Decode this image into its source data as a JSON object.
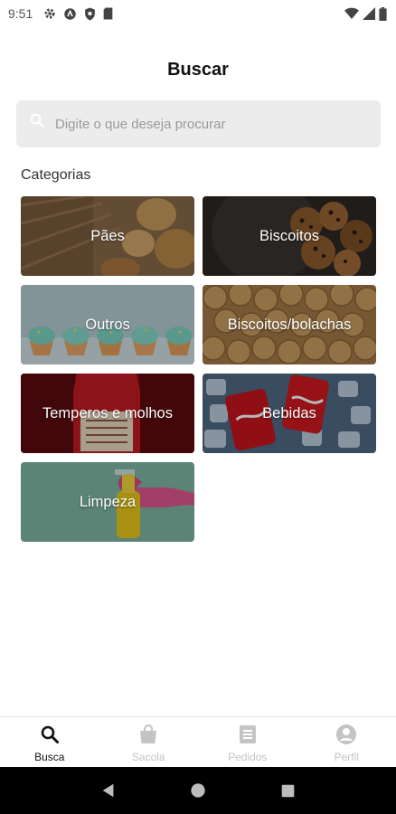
{
  "status_bar": {
    "time": "9:51",
    "icons": [
      "settings-icon",
      "sync-icon",
      "shield-icon",
      "sd-card-icon"
    ],
    "right_icons": [
      "wifi-icon",
      "signal-icon",
      "battery-icon"
    ]
  },
  "header": {
    "title": "Buscar"
  },
  "search": {
    "placeholder": "Digite o que deseja procurar",
    "value": ""
  },
  "categories_label": "Categorias",
  "categories": [
    {
      "label": "Pães",
      "image": "bread"
    },
    {
      "label": "Biscoitos",
      "image": "cookies"
    },
    {
      "label": "Outros",
      "image": "cupcakes"
    },
    {
      "label": "Biscoitos/bolachas",
      "image": "crackers"
    },
    {
      "label": "Temperos e molhos",
      "image": "ketchup"
    },
    {
      "label": "Bebidas",
      "image": "soda-cans"
    },
    {
      "label": "Limpeza",
      "image": "spray-bottle"
    }
  ],
  "bottom_nav": [
    {
      "label": "Busca",
      "icon": "search-icon",
      "active": true
    },
    {
      "label": "Sacola",
      "icon": "bag-icon",
      "active": false
    },
    {
      "label": "Pedidos",
      "icon": "receipt-icon",
      "active": false
    },
    {
      "label": "Perfil",
      "icon": "profile-icon",
      "active": false
    }
  ],
  "system_nav": [
    "back-icon",
    "home-icon",
    "recents-icon"
  ],
  "colors": {
    "search_bg": "#ececec",
    "active_nav": "#111111",
    "inactive_nav": "#c4c4c4"
  }
}
